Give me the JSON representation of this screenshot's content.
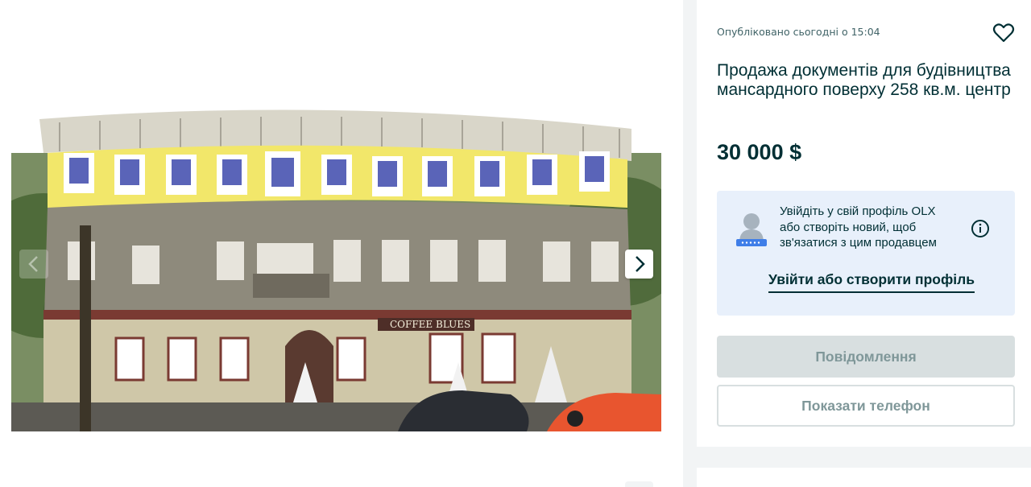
{
  "listing": {
    "published": "Опубліковано сьогодні о 15:04",
    "title": "Продажа документів для будівництва мансардного поверху 258 кв.м. центр",
    "price": "30 000 $"
  },
  "photo": {
    "sign_text": "COFFEE  BLUES",
    "icons": {
      "prev": "chevron-left-icon",
      "next": "chevron-right-icon",
      "favorite": "heart-icon"
    }
  },
  "login_prompt": {
    "text": "Увійдіть у свій профіль OLX або створіть новий, щоб зв'язатися з цим продавцем",
    "link": "Увійти або створити профіль",
    "icons": {
      "avatar": "locked-profile-icon",
      "info": "info-icon"
    }
  },
  "actions": {
    "message": "Повідомлення",
    "show_phone": "Показати телефон"
  },
  "colors": {
    "text": "#002f34",
    "login_bg": "#e8f0fb",
    "disabled_bg": "#d8dfe0",
    "disabled_text": "#7f9799"
  }
}
